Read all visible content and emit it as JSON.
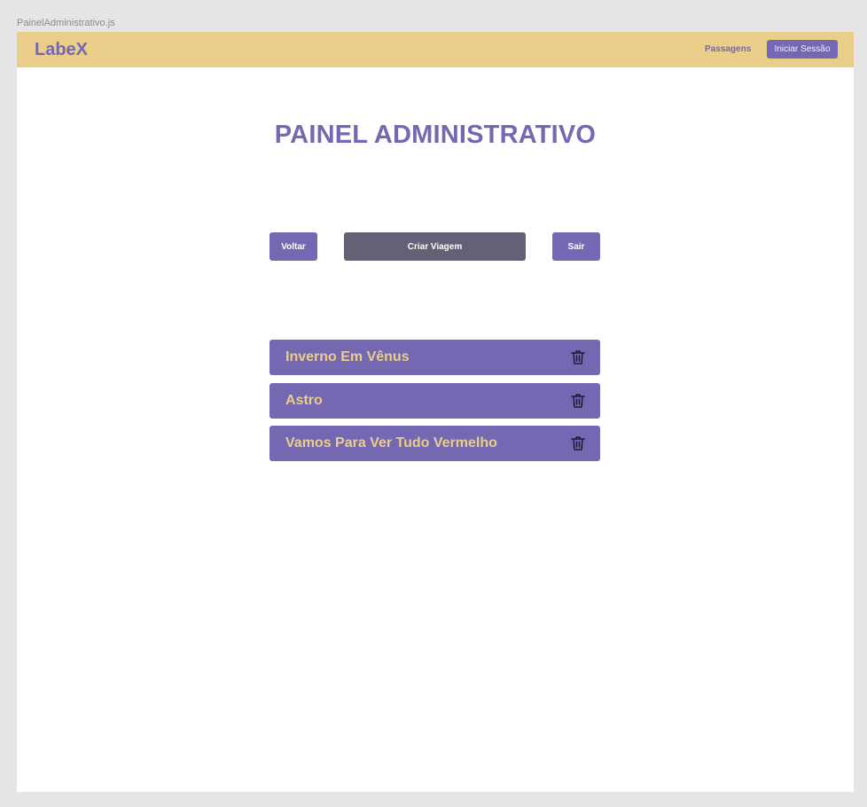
{
  "frame": {
    "label": "PainelAdministrativo.js"
  },
  "navbar": {
    "brand": "LabeX",
    "links": {
      "passagens": "Passagens"
    },
    "login_label": "Iniciar Sessão"
  },
  "page": {
    "title": "PAINEL ADMINISTRATIVO"
  },
  "actions": {
    "back_label": "Voltar",
    "create_label": "Criar Viagem",
    "exit_label": "Sair"
  },
  "trips": [
    {
      "name": "Inverno Em Vênus",
      "icon": "trash-icon"
    },
    {
      "name": "Astro",
      "icon": "trash-icon"
    },
    {
      "name": "Vamos Para Ver Tudo Vermelho",
      "icon": "trash-icon"
    }
  ],
  "colors": {
    "accent": "#7468b2",
    "navbar_bg": "#eacd89",
    "create_button": "#636175",
    "trip_text": "#eacd89"
  }
}
